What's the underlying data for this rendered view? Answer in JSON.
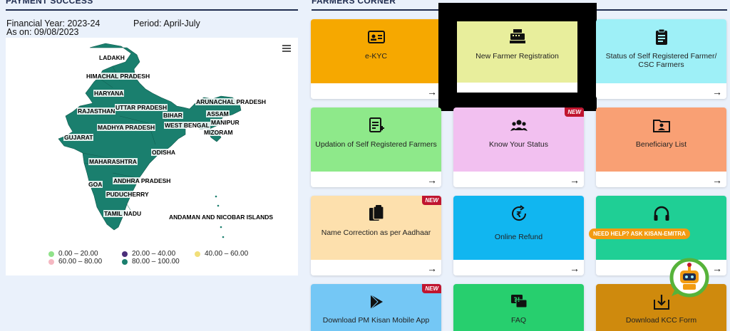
{
  "left": {
    "heading": "PAYMENT SUCCESS",
    "financial_year": "Financial Year: 2023-24",
    "period": "Period: April-July",
    "as_on": "As on: 09/08/2023",
    "menu_icon": "hamburger-icon",
    "states": [
      "LADAKH",
      "HIMACHAL PRADESH",
      "HARYANA",
      "UTTAR PRADESH",
      "RAJASTHAN",
      "BIHAR",
      "ARUNACHAL PRADESH",
      "ASSAM",
      "MANIPUR",
      "WEST BENGAL",
      "MADHYA PRADESH",
      "MIZORAM",
      "GUJARAT",
      "ODISHA",
      "MAHARASHTRA",
      "ANDHRA PRADESH",
      "GOA",
      "PUDUCHERRY",
      "TAMIL NADU",
      "ANDAMAN AND NICOBAR ISLANDS"
    ],
    "legend": [
      {
        "label": "0.00 – 20.00",
        "color": "#90e28a"
      },
      {
        "label": "20.00 – 40.00",
        "color": "#4b2f7a"
      },
      {
        "label": "40.00 – 60.00",
        "color": "#f1df7a"
      },
      {
        "label": "60.00 – 80.00",
        "color": "#f5b8c2"
      },
      {
        "label": "80.00 – 100.00",
        "color": "#1a7f6e"
      }
    ]
  },
  "right": {
    "heading": "FARMERS CORNER",
    "cards": [
      {
        "label": "e-KYC",
        "color": "#f6a800",
        "icon": "id-card-icon",
        "new": ""
      },
      {
        "label": "New Farmer Registration",
        "color": "#e8ee9c",
        "icon": "cash-register-icon",
        "new": ""
      },
      {
        "label": "Status of Self Registered Farmer/ CSC Farmers",
        "color": "#9ef0f7",
        "icon": "clipboard-icon",
        "new": ""
      },
      {
        "label": "Updation of Self Registered Farmers",
        "color": "#8ee98a",
        "icon": "edit-list-icon",
        "new": ""
      },
      {
        "label": "Know Your Status",
        "color": "#f2c0f0",
        "icon": "users-icon",
        "new": "NEW"
      },
      {
        "label": "Beneficiary List",
        "color": "#f9a074",
        "icon": "folder-user-icon",
        "new": ""
      },
      {
        "label": "Name Correction as per Aadhaar",
        "color": "#fde0ad",
        "icon": "clipboard-paste-icon",
        "new": "NEW"
      },
      {
        "label": "Online Refund",
        "color": "#11b6f0",
        "icon": "rupee-refund-icon",
        "new": ""
      },
      {
        "label": "",
        "color": "#1fcf95",
        "icon": "headphones-icon",
        "new": ""
      },
      {
        "label": "Download PM Kisan Mobile App",
        "color": "#74c7f5",
        "icon": "play-store-icon",
        "new": "NEW"
      },
      {
        "label": "FAQ",
        "color": "#27cf6e",
        "icon": "faq-icon",
        "new": ""
      },
      {
        "label": "Download KCC Form",
        "color": "#cf8a0d",
        "icon": "download-box-icon",
        "new": ""
      }
    ],
    "arrow": "→",
    "help_text": "NEED HELP? ASK KISAN-EMITRA",
    "chatbot_icon": "robot-icon"
  }
}
